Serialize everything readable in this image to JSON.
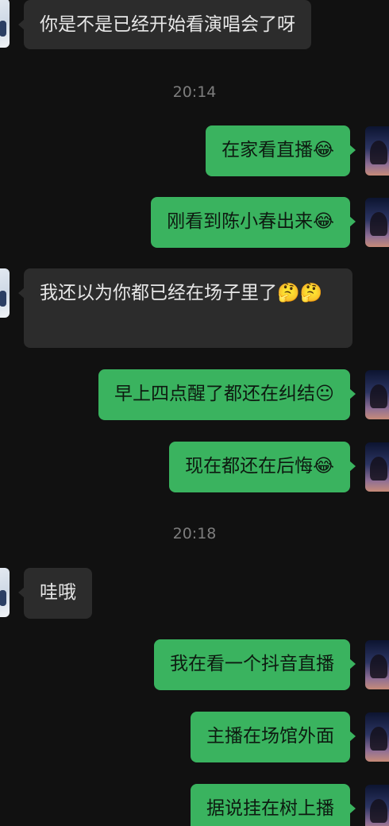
{
  "timestamps": [
    "20:14",
    "20:18"
  ],
  "messages": [
    {
      "sender": "other",
      "text": "你是不是已经开始看演唱会了呀"
    },
    {
      "sender": "me",
      "text": "在家看直播😂"
    },
    {
      "sender": "me",
      "text": "刚看到陈小春出来😂"
    },
    {
      "sender": "other",
      "text": "我还以为你都已经在场子里了🤔🤔"
    },
    {
      "sender": "me",
      "text": "早上四点醒了都还在纠结😐"
    },
    {
      "sender": "me",
      "text": "现在都还在后悔😂"
    },
    {
      "sender": "other",
      "text": "哇哦"
    },
    {
      "sender": "me",
      "text": "我在看一个抖音直播"
    },
    {
      "sender": "me",
      "text": "主播在场馆外面"
    },
    {
      "sender": "me",
      "text": "据说挂在树上播"
    }
  ],
  "colors": {
    "background": "#111111",
    "outgoing_bubble": "#3ab35f",
    "incoming_bubble": "#2c2c2c",
    "timestamp_text": "#7d7d7d"
  }
}
